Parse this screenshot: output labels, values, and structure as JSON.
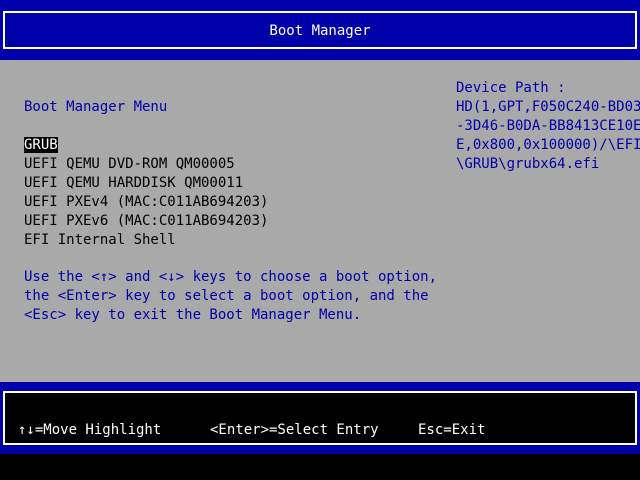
{
  "header": {
    "title": "Boot Manager"
  },
  "menu": {
    "heading": "Boot Manager Menu",
    "items": [
      {
        "label": "GRUB",
        "selected": true
      },
      {
        "label": "UEFI QEMU DVD-ROM QM00005",
        "selected": false
      },
      {
        "label": "UEFI QEMU HARDDISK QM00011",
        "selected": false
      },
      {
        "label": "UEFI PXEv4 (MAC:C011AB694203)",
        "selected": false
      },
      {
        "label": "UEFI PXEv6 (MAC:C011AB694203)",
        "selected": false
      },
      {
        "label": "EFI Internal Shell",
        "selected": false
      }
    ]
  },
  "help": {
    "lines": [
      "Use the <↑> and <↓> keys to choose a boot option,",
      "the <Enter> key to select a boot option, and the",
      "<Esc> key to exit the Boot Manager Menu."
    ]
  },
  "device_path": {
    "label": "Device Path :",
    "lines": [
      "HD(1,GPT,F050C240-BD03",
      "-3D46-B0DA-BB8413CE10E",
      "E,0x800,0x100000)/\\EFI",
      "\\GRUB\\grubx64.efi"
    ]
  },
  "footer": {
    "move_hint": "↑↓=Move Highlight",
    "enter_hint": "<Enter>=Select Entry",
    "esc_hint": "Esc=Exit"
  },
  "colors": {
    "title_band": "#0000aa",
    "main_background": "#a9a9a9",
    "accent_text": "#0000aa",
    "selection_background": "#000000",
    "footer_background": "#000000"
  }
}
